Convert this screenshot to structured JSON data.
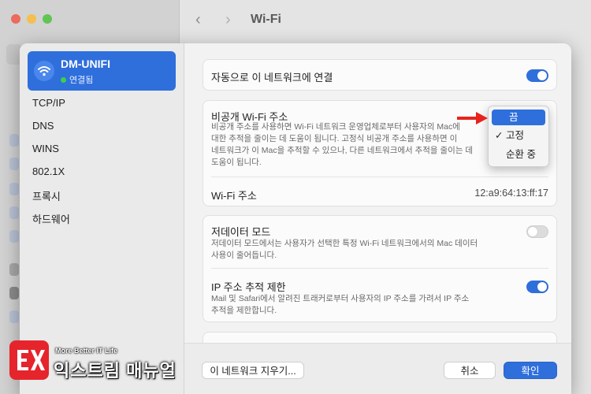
{
  "background": {
    "title": "Wi-Fi",
    "back_glyph": "‹",
    "forward_glyph": "›"
  },
  "sidebar": {
    "network": {
      "name": "DM-UNIFI",
      "status": "연결됨",
      "icon": "wifi-icon"
    },
    "items": [
      {
        "label": "TCP/IP"
      },
      {
        "label": "DNS"
      },
      {
        "label": "WINS"
      },
      {
        "label": "802.1X"
      },
      {
        "label": "프록시"
      },
      {
        "label": "하드웨어"
      }
    ]
  },
  "main": {
    "auto_join": {
      "label": "자동으로 이 네트워크에 연결",
      "enabled": true
    },
    "private_address": {
      "label": "비공개 Wi-Fi 주소",
      "desc_lines": [
        "비공개 주소를 사용하면 Wi-Fi 네트워크 운영업체로부터 사용자의 Mac에",
        "대한 추적을 줄이는 데 도움이 됩니다. 고정식 비공개 주소를 사용하면 이",
        "네트워크가 이 Mac을 추적할 수 있으나, 다른 네트워크에서 추적을 줄이는 데",
        "도움이 됩니다."
      ]
    },
    "wifi_address": {
      "label": "Wi-Fi 주소",
      "value": "12:a9:64:13:ff:17"
    },
    "low_data_mode": {
      "label": "저데이터 모드",
      "enabled": false,
      "desc_lines": [
        "저데이터 모드에서는 사용자가 선택한 특정 Wi-Fi 네트워크에서의 Mac 데이터",
        "사용이 줄어듭니다."
      ]
    },
    "limit_ip_tracking": {
      "label": "IP 주소 추적 제한",
      "enabled": true,
      "desc_lines": [
        "Mail 및 Safari에서 알려진 트래커로부터 사용자의 IP 주소를 가려서 IP 주소",
        "추적을 제한합니다."
      ]
    }
  },
  "dropdown": {
    "options": [
      {
        "label": "끔",
        "highlighted": true,
        "checked": false
      },
      {
        "label": "고정",
        "highlighted": false,
        "checked": true
      },
      {
        "label": "순환 중",
        "highlighted": false,
        "checked": false
      }
    ],
    "check_glyph": "✓"
  },
  "footer": {
    "forget_label": "이 네트워크 지우기...",
    "cancel_label": "취소",
    "ok_label": "확인"
  },
  "watermark": {
    "tagline": "More Better IT Life",
    "name": "익스트림 매뉴얼",
    "logo_letters": "EX"
  },
  "colors": {
    "accent": "#2f6fdc",
    "arrow": "#e8231d",
    "status_green": "#3ecf4b",
    "logo_red": "#e6242c"
  }
}
